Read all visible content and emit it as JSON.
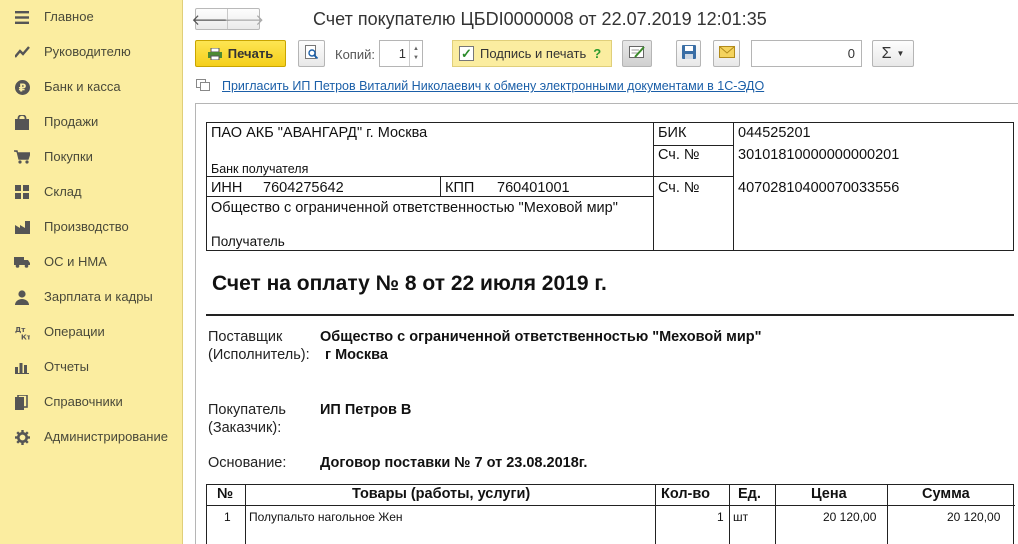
{
  "sidebar": {
    "items": [
      {
        "label": "Главное",
        "icon": "menu-icon"
      },
      {
        "label": "Руководителю",
        "icon": "trend-icon"
      },
      {
        "label": "Банк и касса",
        "icon": "ruble-icon"
      },
      {
        "label": "Продажи",
        "icon": "bag-icon"
      },
      {
        "label": "Покупки",
        "icon": "cart-icon"
      },
      {
        "label": "Склад",
        "icon": "grid-icon"
      },
      {
        "label": "Производство",
        "icon": "factory-icon"
      },
      {
        "label": "ОС и НМА",
        "icon": "truck-icon"
      },
      {
        "label": "Зарплата и кадры",
        "icon": "person-icon"
      },
      {
        "label": "Операции",
        "icon": "dt-kt-icon"
      },
      {
        "label": "Отчеты",
        "icon": "bar-chart-icon"
      },
      {
        "label": "Справочники",
        "icon": "books-icon"
      },
      {
        "label": "Администрирование",
        "icon": "gear-icon"
      }
    ]
  },
  "header": {
    "back": "🡐",
    "forward": "🡒",
    "title": "Счет покупателю ЦБDI0000008 от 22.07.2019 12:01:35"
  },
  "toolbar": {
    "print_label": "Печать",
    "copies_label": "Копий:",
    "copies_value": "1",
    "sign_print_label": "Подпись и печать",
    "help_mark": "?",
    "number_value": "0",
    "sum_symbol": "Σ"
  },
  "invite_link": "Пригласить ИП Петров Виталий Николаевич к обмену электронными документами в 1С-ЭДО",
  "bank_block": {
    "bank_name": "ПАО АКБ \"АВАНГАРД\" г. Москва",
    "bank_caption": "Банк получателя",
    "bik_label": "БИК",
    "bik_value": "044525201",
    "corr_label": "Сч. №",
    "corr_value": "30101810000000000201",
    "inn_label": "ИНН",
    "inn_value": "7604275642",
    "kpp_label": "КПП",
    "kpp_value": "760401001",
    "acc_label": "Сч. №",
    "acc_value": "40702810400070033556",
    "recipient_name": "Общество с ограниченной ответственностью \"Меховой мир\"",
    "recipient_caption": "Получатель"
  },
  "invoice": {
    "title": "Счет на оплату № 8 от 22 июля 2019 г.",
    "supplier_label_1": "Поставщик",
    "supplier_label_2": "(Исполнитель):",
    "supplier_value_1": "Общество с ограниченной ответственностью \"Меховой мир\"",
    "supplier_value_2": "г Москва",
    "buyer_label_1": "Покупатель",
    "buyer_label_2": "(Заказчик):",
    "buyer_value": "ИП Петров В",
    "basis_label": "Основание:",
    "basis_value": "Договор поставки № 7 от 23.08.2018г."
  },
  "items_table": {
    "headers": [
      "№",
      "Товары (работы, услуги)",
      "Кол-во",
      "Ед.",
      "Цена",
      "Сумма"
    ],
    "rows": [
      {
        "num": "1",
        "name": "Полупальто нагольное Жен",
        "qty": "1",
        "unit": "шт",
        "price": "20 120,00",
        "sum": "20 120,00"
      }
    ]
  },
  "colors": {
    "sidebar_bg": "#fbeda0",
    "print_button": "#f5cf1b",
    "link": "#1b5fa8"
  }
}
